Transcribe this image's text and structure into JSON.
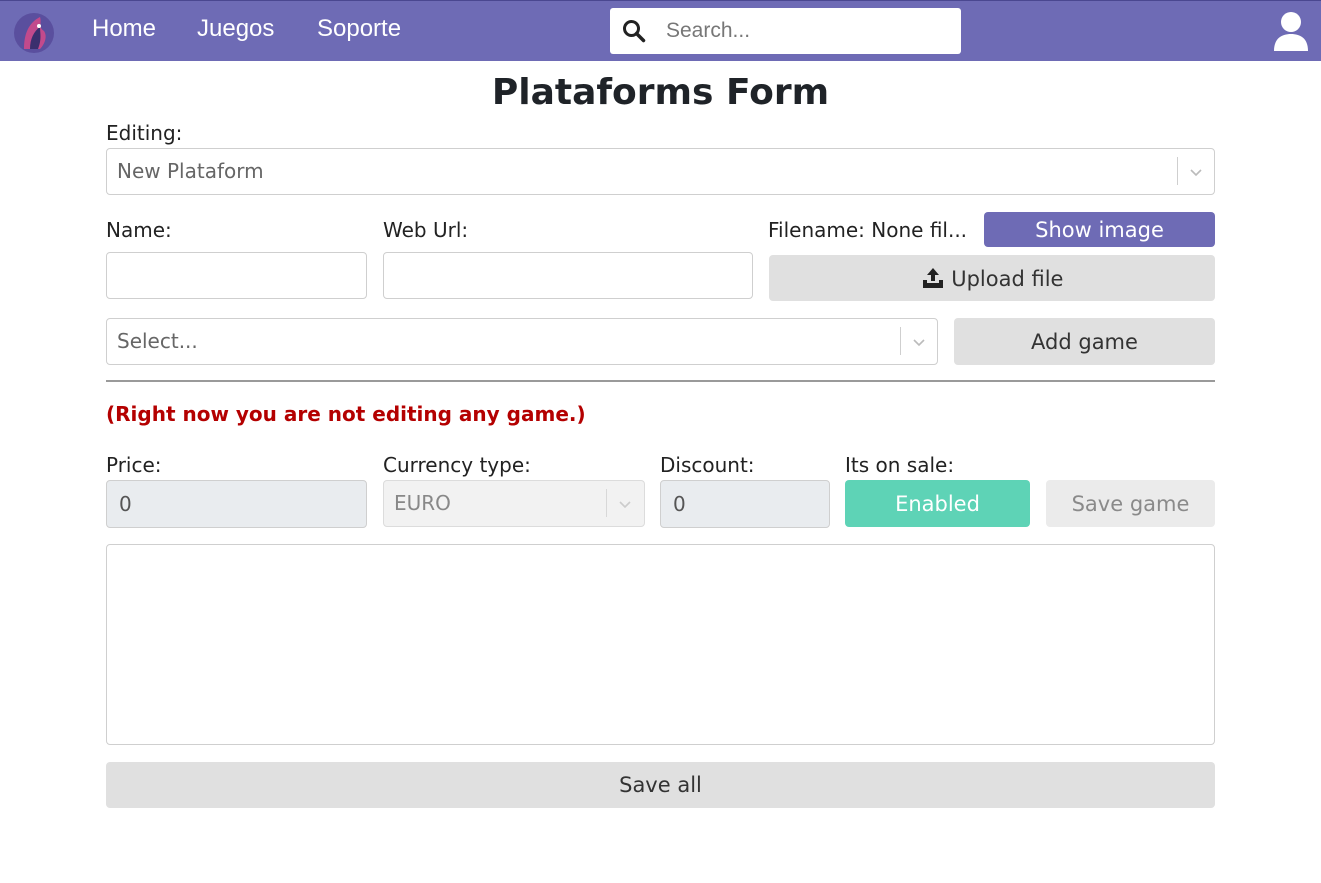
{
  "nav": {
    "links": [
      "Home",
      "Juegos",
      "Soporte"
    ],
    "search_placeholder": "Search..."
  },
  "form": {
    "title": "Plataforms Form",
    "editing_label": "Editing:",
    "editing_value": "New Plataform",
    "name_label": "Name:",
    "name_value": "",
    "weburl_label": "Web Url:",
    "weburl_value": "",
    "filename_label": "Filename: None fil...",
    "show_image_label": "Show image",
    "upload_label": "Upload file",
    "game_select_placeholder": "Select...",
    "add_game_label": "Add game",
    "notice": "(Right now you are not editing any game.)",
    "price_label": "Price:",
    "price_value": "0",
    "currency_label": "Currency type:",
    "currency_value": "EURO",
    "discount_label": "Discount:",
    "discount_value": "0",
    "on_sale_label": "Its on sale:",
    "on_sale_state": "Enabled",
    "save_game_label": "Save game",
    "description_value": "",
    "save_all_label": "Save all"
  },
  "colors": {
    "nav_bg": "#6e6bb5",
    "primary": "#6e6bb5",
    "enabled": "#5ed3b6",
    "notice": "#b40000"
  },
  "icons": {
    "logo": "knight-logo-icon",
    "search": "search-icon",
    "user": "user-icon",
    "upload": "upload-icon",
    "chevron": "chevron-down-icon"
  }
}
